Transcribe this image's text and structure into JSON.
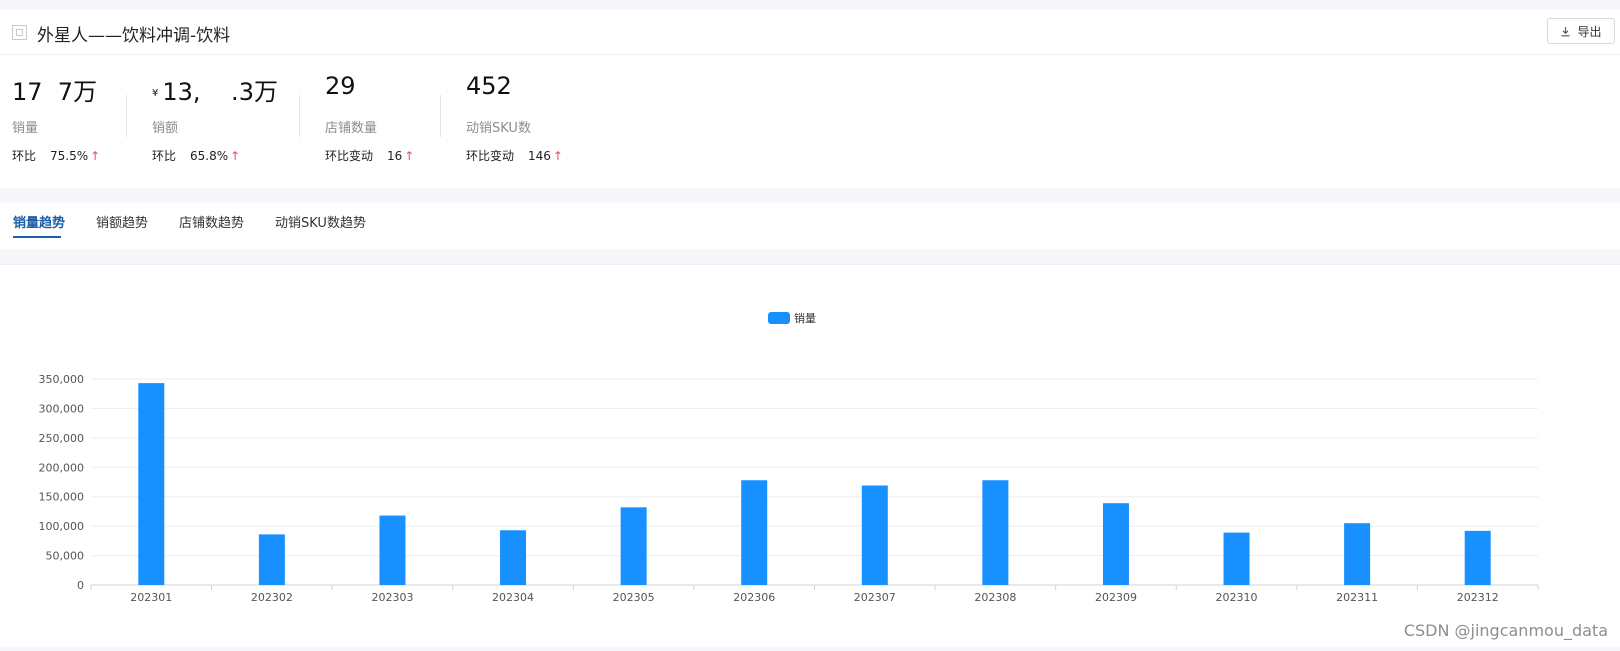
{
  "header": {
    "title": "外星人——饮料冲调-饮料",
    "export_label": "导出"
  },
  "metrics": [
    {
      "value": "17  7万",
      "currency": "",
      "label": "销量",
      "change_label": "环比",
      "change_value": "75.5%",
      "arrow": "↑"
    },
    {
      "value": "13,    .3万",
      "currency": "¥",
      "label": "销额",
      "change_label": "环比",
      "change_value": "65.8%",
      "arrow": "↑"
    },
    {
      "value": "29",
      "currency": "",
      "label": "店铺数量",
      "change_label": "环比变动",
      "change_value": "16",
      "arrow": "↑"
    },
    {
      "value": "452",
      "currency": "",
      "label": "动销SKU数",
      "change_label": "环比变动",
      "change_value": "146",
      "arrow": "↑"
    }
  ],
  "tabs": [
    {
      "label": "销量趋势",
      "active": true
    },
    {
      "label": "销额趋势",
      "active": false
    },
    {
      "label": "店铺数趋势",
      "active": false
    },
    {
      "label": "动销SKU数趋势",
      "active": false
    }
  ],
  "watermark": "CSDN @jingcanmou_data",
  "colors": {
    "bar": "#1890ff",
    "active_tab": "#1f5faa",
    "arrow_up": "#e8505b"
  },
  "chart_data": {
    "type": "bar",
    "categories": [
      "202301",
      "202302",
      "202303",
      "202304",
      "202305",
      "202306",
      "202307",
      "202308",
      "202309",
      "202310",
      "202311",
      "202312"
    ],
    "series": [
      {
        "name": "销量",
        "values": [
          343000,
          86000,
          118000,
          93000,
          132000,
          178000,
          169000,
          178000,
          139000,
          89000,
          105000,
          92000
        ]
      }
    ],
    "ylim": [
      0,
      350000
    ],
    "yticks": [
      0,
      50000,
      100000,
      150000,
      200000,
      250000,
      300000,
      350000
    ],
    "ytick_labels": [
      "0",
      "50,000",
      "100,000",
      "150,000",
      "200,000",
      "250,000",
      "300,000",
      "350,000"
    ],
    "legend_position": "top-center",
    "grid": true
  }
}
